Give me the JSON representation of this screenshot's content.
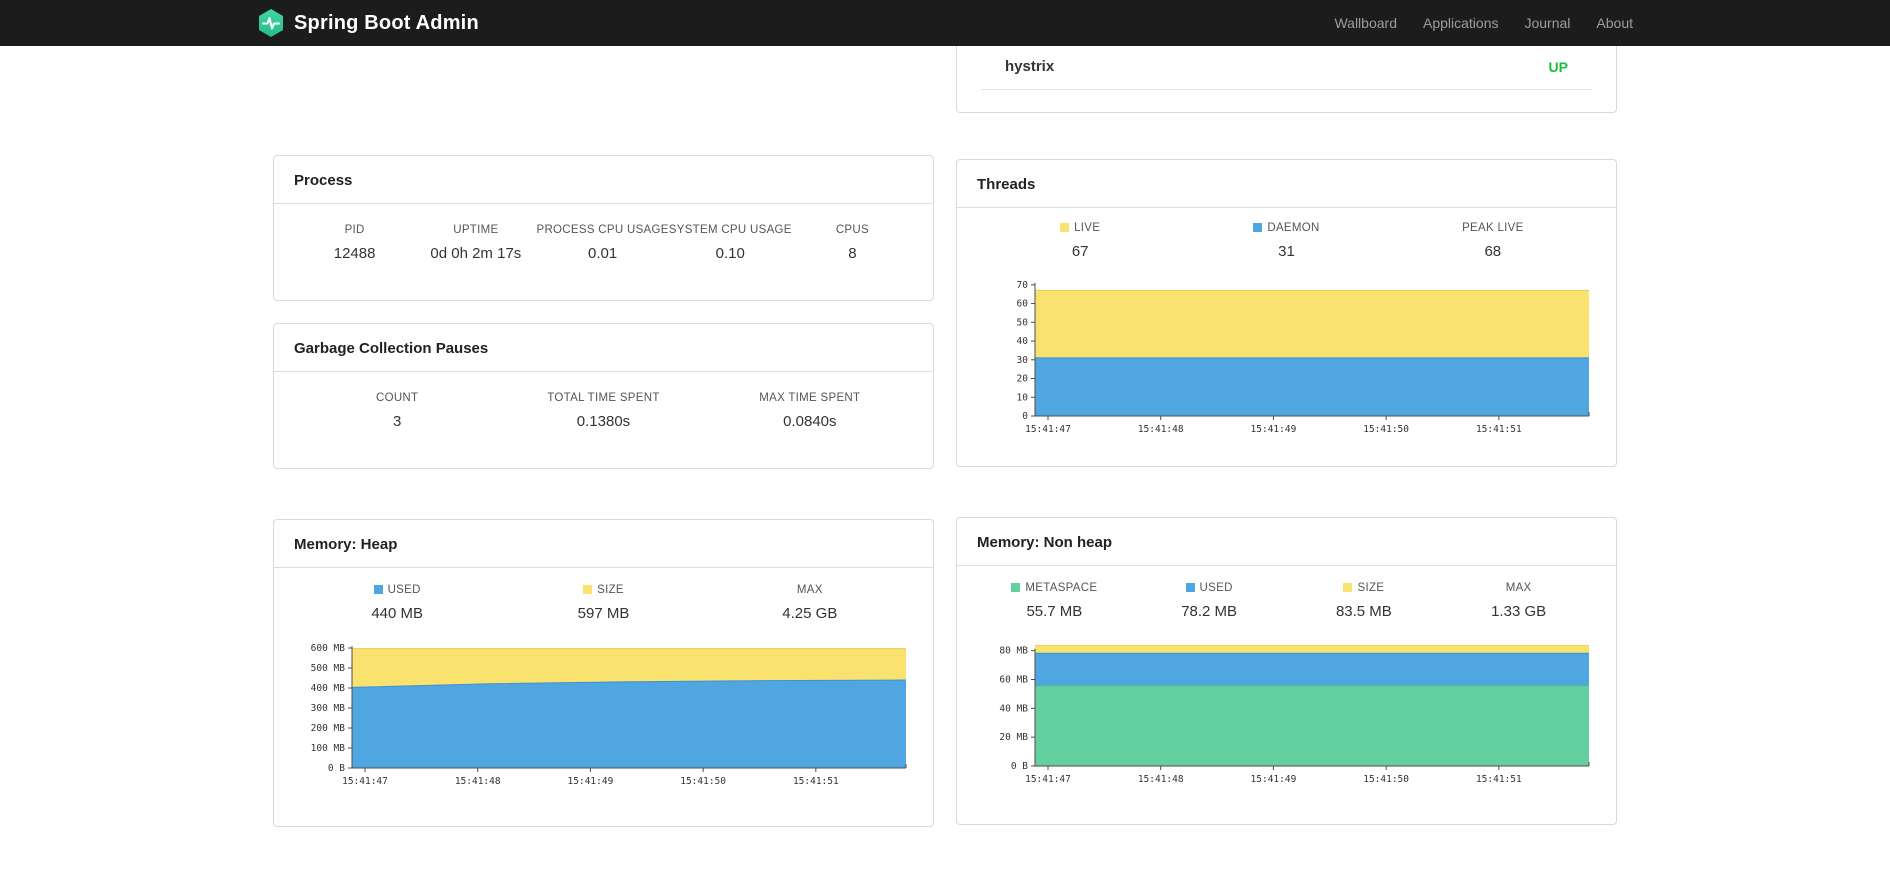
{
  "navbar": {
    "brand": "Spring Boot Admin",
    "items": [
      {
        "label": "Wallboard"
      },
      {
        "label": "Applications"
      },
      {
        "label": "Journal"
      },
      {
        "label": "About"
      }
    ]
  },
  "colors": {
    "yellow": "#fae26e",
    "blue": "#50a6e0",
    "green": "#64d0a0",
    "status_up": "#1dbc3f",
    "navbar_bg": "#1c1c1c"
  },
  "health": {
    "rows": [
      {
        "name": "hystrix",
        "status": "UP"
      }
    ],
    "status_color": "#1dbc3f"
  },
  "process": {
    "title": "Process",
    "metrics": [
      {
        "label": "PID",
        "value": "12488"
      },
      {
        "label": "UPTIME",
        "value": "0d 0h 2m 17s"
      },
      {
        "label": "PROCESS CPU USAGE",
        "value": "0.01"
      },
      {
        "label": "SYSTEM CPU USAGE",
        "value": "0.10"
      },
      {
        "label": "CPUS",
        "value": "8"
      }
    ]
  },
  "gc": {
    "title": "Garbage Collection Pauses",
    "metrics": [
      {
        "label": "COUNT",
        "value": "3"
      },
      {
        "label": "TOTAL TIME SPENT",
        "value": "0.1380s"
      },
      {
        "label": "MAX TIME SPENT",
        "value": "0.0840s"
      }
    ]
  },
  "threads": {
    "title": "Threads",
    "metrics": [
      {
        "label": "LIVE",
        "value": "67",
        "color": "#fae26e"
      },
      {
        "label": "DAEMON",
        "value": "31",
        "color": "#50a6e0"
      },
      {
        "label": "PEAK LIVE",
        "value": "68"
      }
    ]
  },
  "heap": {
    "title": "Memory: Heap",
    "metrics": [
      {
        "label": "USED",
        "value": "440 MB",
        "color": "#50a6e0"
      },
      {
        "label": "SIZE",
        "value": "597 MB",
        "color": "#fae26e"
      },
      {
        "label": "MAX",
        "value": "4.25 GB"
      }
    ]
  },
  "nonheap": {
    "title": "Memory: Non heap",
    "metrics": [
      {
        "label": "METASPACE",
        "value": "55.7 MB",
        "color": "#64d0a0"
      },
      {
        "label": "USED",
        "value": "78.2 MB",
        "color": "#50a6e0"
      },
      {
        "label": "SIZE",
        "value": "83.5 MB",
        "color": "#fae26e"
      },
      {
        "label": "MAX",
        "value": "1.33 GB"
      }
    ]
  },
  "chart_data": [
    {
      "id": "threads",
      "type": "area",
      "title": "Threads",
      "xlabel": "",
      "ylabel": "",
      "x": [
        "15:41:47",
        "15:41:48",
        "15:41:49",
        "15:41:50",
        "15:41:51"
      ],
      "ylim": [
        0,
        71.5
      ],
      "yticks": [
        {
          "v": 70,
          "label": "70"
        },
        {
          "v": 60,
          "label": "60"
        },
        {
          "v": 50,
          "label": "50"
        },
        {
          "v": 40,
          "label": "40"
        },
        {
          "v": 30,
          "label": "30"
        },
        {
          "v": 20,
          "label": "20"
        },
        {
          "v": 10,
          "label": "10"
        },
        {
          "v": 0,
          "label": "0"
        }
      ],
      "legend_position": "top",
      "grid": false,
      "layers": [
        {
          "name": "LIVE",
          "fill": "#fae26e",
          "stroke": "#e6cd55",
          "values": [
            67,
            67,
            67,
            67,
            67
          ]
        },
        {
          "name": "DAEMON",
          "fill": "#50a6e0",
          "stroke": "#3b92d4",
          "values": [
            31,
            31,
            31,
            31,
            31
          ]
        }
      ]
    },
    {
      "id": "heap",
      "type": "area",
      "title": "Memory: Heap",
      "xlabel": "",
      "ylabel": "",
      "x": [
        "15:41:47",
        "15:41:48",
        "15:41:49",
        "15:41:50",
        "15:41:51"
      ],
      "ylim": [
        0,
        620
      ],
      "yticks": [
        {
          "v": 600,
          "label": "600 MB"
        },
        {
          "v": 500,
          "label": "500 MB"
        },
        {
          "v": 400,
          "label": "400 MB"
        },
        {
          "v": 300,
          "label": "300 MB"
        },
        {
          "v": 200,
          "label": "200 MB"
        },
        {
          "v": 100,
          "label": "100 MB"
        },
        {
          "v": 0,
          "label": "0 B"
        }
      ],
      "legend_position": "top",
      "grid": false,
      "layers": [
        {
          "name": "SIZE",
          "fill": "#fae26e",
          "stroke": "#e6cd55",
          "values": [
            597,
            597,
            597,
            597,
            597
          ]
        },
        {
          "name": "USED",
          "fill": "#50a6e0",
          "stroke": "#3b92d4",
          "values": [
            403,
            421,
            431,
            437,
            440
          ]
        }
      ]
    },
    {
      "id": "nonheap",
      "type": "area",
      "title": "Memory: Non heap",
      "xlabel": "",
      "ylabel": "",
      "x": [
        "15:41:47",
        "15:41:48",
        "15:41:49",
        "15:41:50",
        "15:41:51"
      ],
      "ylim": [
        0,
        86
      ],
      "yticks": [
        {
          "v": 80,
          "label": "80 MB"
        },
        {
          "v": 60,
          "label": "60 MB"
        },
        {
          "v": 40,
          "label": "40 MB"
        },
        {
          "v": 20,
          "label": "20 MB"
        },
        {
          "v": 0,
          "label": "0 B"
        }
      ],
      "legend_position": "top",
      "grid": false,
      "layers": [
        {
          "name": "SIZE",
          "fill": "#fae26e",
          "stroke": "#e6cd55",
          "values": [
            83.5,
            83.5,
            83.5,
            83.5,
            83.5
          ]
        },
        {
          "name": "USED",
          "fill": "#50a6e0",
          "stroke": "#3b92d4",
          "values": [
            78.2,
            78.2,
            78.2,
            78.2,
            78.2
          ]
        },
        {
          "name": "METASPACE",
          "fill": "#64d0a0",
          "stroke": "#4cbd8f",
          "values": [
            55.7,
            55.7,
            55.7,
            55.7,
            55.7
          ]
        }
      ]
    }
  ]
}
